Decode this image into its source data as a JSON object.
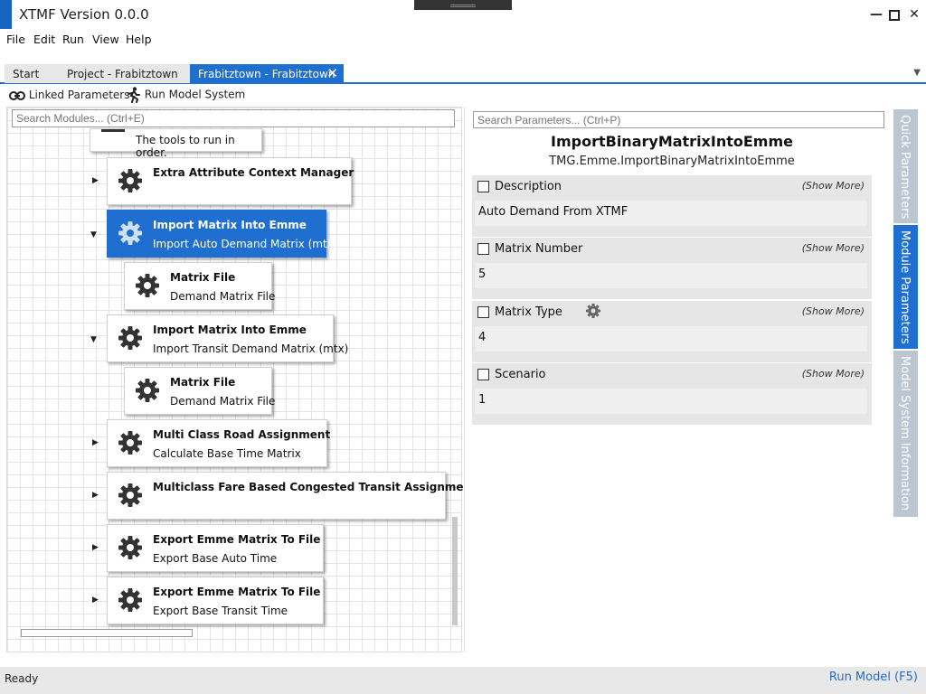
{
  "window": {
    "title": "XTMF Version 0.0.0"
  },
  "menu": [
    {
      "label": "File"
    },
    {
      "label": "Edit"
    },
    {
      "label": "Run"
    },
    {
      "label": "View"
    },
    {
      "label": "Help"
    }
  ],
  "tabs": [
    {
      "label": "Start"
    },
    {
      "label": "Project - Frabitztown"
    },
    {
      "label": "Frabitztown - Frabitztown",
      "active": true,
      "close": "✕"
    }
  ],
  "toolbar": {
    "linked_parameters": "Linked Parameters",
    "run_model_system": "Run Model System"
  },
  "modules_panel": {
    "search_placeholder": "Search Modules... (Ctrl+E)",
    "top_caption": "The tools to run in order.",
    "modules": [
      {
        "title": "Extra Attribute Context Manager",
        "subtitle": "",
        "expander": "▶"
      },
      {
        "title": "Import Matrix Into Emme",
        "subtitle": "Import Auto Demand Matrix (mtx)",
        "expander": "▼",
        "selected": true
      },
      {
        "title": "Matrix File",
        "subtitle": "Demand Matrix File"
      },
      {
        "title": "Import Matrix Into Emme",
        "subtitle": "Import Transit Demand Matrix (mtx)",
        "expander": "▼"
      },
      {
        "title": "Matrix File",
        "subtitle": "Demand Matrix File"
      },
      {
        "title": "Multi Class Road Assignment",
        "subtitle": "Calculate Base Time Matrix",
        "expander": "▶"
      },
      {
        "title": "Multiclass Fare Based Congested Transit Assignment",
        "subtitle": "",
        "expander": "▶"
      },
      {
        "title": "Export Emme Matrix To File",
        "subtitle": "Export Base Auto Time",
        "expander": "▶"
      },
      {
        "title": "Export Emme Matrix To File",
        "subtitle": "Export Base Transit Time",
        "expander": "▶"
      }
    ]
  },
  "parameters_panel": {
    "search_placeholder": "Search Parameters... (Ctrl+P)",
    "module_name": "ImportBinaryMatrixIntoEmme",
    "module_type": "TMG.Emme.ImportBinaryMatrixIntoEmme",
    "show_more": "(Show More)",
    "parameters": [
      {
        "name": "Description",
        "value": "Auto Demand From XTMF"
      },
      {
        "name": "Matrix Number",
        "value": "5"
      },
      {
        "name": "Matrix Type",
        "value": "4",
        "has_gear": true
      },
      {
        "name": "Scenario",
        "value": "1"
      }
    ]
  },
  "side_tabs": [
    {
      "label": "Quick Parameters"
    },
    {
      "label": "Module Parameters",
      "active": true
    },
    {
      "label": "Model System Information"
    }
  ],
  "status": {
    "text": "Ready",
    "run_model": "Run Model (F5)"
  },
  "colors": {
    "accent": "#1e6fd0",
    "side_tab_inactive": "#bcc6d1"
  }
}
